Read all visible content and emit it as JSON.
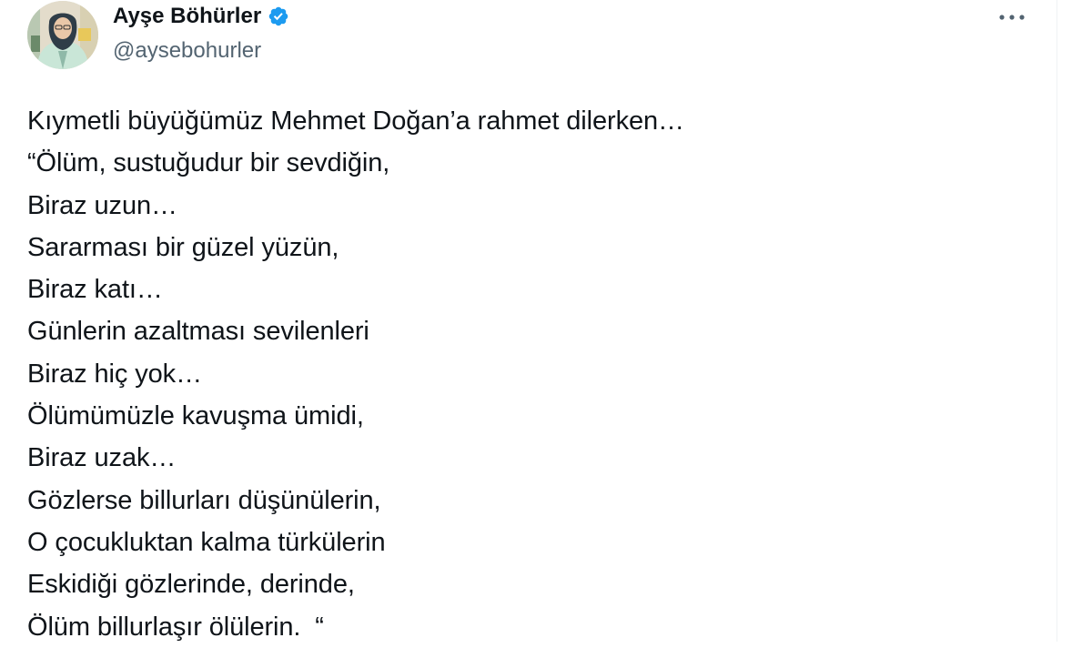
{
  "tweet": {
    "author": {
      "display_name": "Ayşe Böhürler",
      "handle": "@aysebohurler",
      "verified_icon": "verified-badge-icon",
      "verified_color": "#1d9bf0",
      "avatar": "profile-photo"
    },
    "more_icon": "more-horizontal-icon",
    "text_lines": [
      "Kıymetli büyüğümüz Mehmet Doğan’a rahmet dilerken…",
      "“Ölüm, sustuğudur bir sevdiğin,",
      "Biraz uzun…",
      "Sararması bir güzel yüzün,",
      "Biraz katı…",
      "Günlerin azaltması sevilenleri",
      "Biraz hiç yok…",
      "Ölümümüzle kavuşma ümidi,",
      "Biraz uzak…",
      "Gözlerse billurları düşünülerin,",
      "O çocukluktan kalma türkülerin",
      "Eskidiği gözlerinde, derinde,",
      "Ölüm billurlaşır ölülerin.  “"
    ]
  },
  "colors": {
    "text_primary": "#0f1419",
    "text_secondary": "#536471",
    "accent": "#1d9bf0",
    "divider": "#eff3f4"
  }
}
